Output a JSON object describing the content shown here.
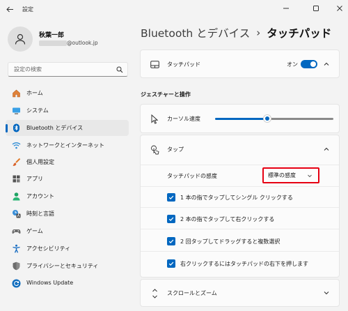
{
  "window": {
    "title": "設定"
  },
  "profile": {
    "name": "秋葉一郎",
    "email_suffix": "@outlook.jp"
  },
  "search": {
    "placeholder": "設定の検索"
  },
  "sidebar": {
    "items": [
      {
        "label": "ホーム",
        "icon": "home-icon"
      },
      {
        "label": "システム",
        "icon": "system-icon"
      },
      {
        "label": "Bluetooth とデバイス",
        "icon": "bluetooth-icon",
        "selected": true
      },
      {
        "label": "ネットワークとインターネット",
        "icon": "wifi-icon"
      },
      {
        "label": "個人用設定",
        "icon": "brush-icon"
      },
      {
        "label": "アプリ",
        "icon": "apps-icon"
      },
      {
        "label": "アカウント",
        "icon": "account-icon"
      },
      {
        "label": "時刻と言語",
        "icon": "time-language-icon"
      },
      {
        "label": "ゲーム",
        "icon": "gamepad-icon"
      },
      {
        "label": "アクセシビリティ",
        "icon": "accessibility-icon"
      },
      {
        "label": "プライバシーとセキュリティ",
        "icon": "shield-icon"
      },
      {
        "label": "Windows Update",
        "icon": "update-icon"
      }
    ]
  },
  "breadcrumb": {
    "parent": "Bluetooth とデバイス",
    "separator": "›",
    "current": "タッチパッド"
  },
  "touchpad": {
    "label": "タッチパッド",
    "toggle_state": "オン"
  },
  "gestures": {
    "section_title": "ジェスチャーと操作"
  },
  "cursor_speed": {
    "label": "カーソル速度",
    "value_fraction": 0.44
  },
  "tap": {
    "label": "タップ",
    "sensitivity_label": "タッチパッドの感度",
    "sensitivity_value": "標準の感度",
    "options": [
      {
        "label": "1 本の指でタップしてシングル クリックする",
        "checked": true
      },
      {
        "label": "2 本の指でタップして右クリックする",
        "checked": true
      },
      {
        "label": "2 回タップしてドラッグすると複数選択",
        "checked": true
      },
      {
        "label": "右クリックするにはタッチパッドの右下を押します",
        "checked": true
      }
    ]
  },
  "scroll_zoom": {
    "label": "スクロールとズーム"
  },
  "colors": {
    "accent": "#0067c0",
    "highlight": "#e60012"
  }
}
